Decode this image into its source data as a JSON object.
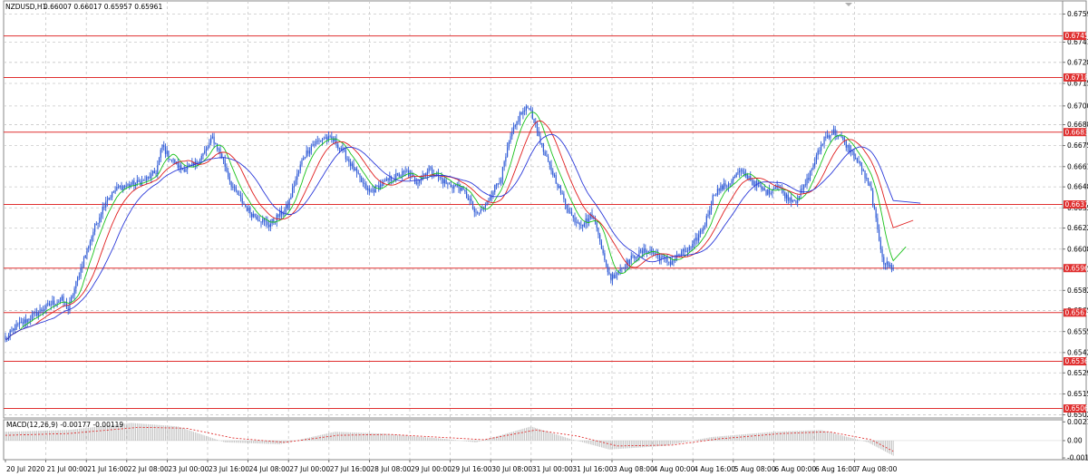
{
  "symbol_info": "NZDUSD,H1",
  "ohlc_info": "0.66007 0.66017 0.65957 0.65961",
  "macd_label": "MACD(12,26,9) -0.00177 -0.00119",
  "colors": {
    "candle": "#2f5bd6",
    "ma_fast": "#19c219",
    "ma_mid": "#e01e1e",
    "ma_slow": "#2b39d9",
    "level": "#e03030",
    "macd_hist": "#b9b9b9",
    "macd_signal": "#e03030"
  },
  "chart_data": {
    "type": "candlestick",
    "price_ticks": [
      "0.67595",
      "0.67415",
      "0.67285",
      "0.67150",
      "0.67005",
      "0.66885",
      "0.66750",
      "0.66615",
      "0.66485",
      "0.66350",
      "0.66220",
      "0.66085",
      "0.65955",
      "0.65820",
      "0.65690",
      "0.65555",
      "0.65420",
      "0.65290",
      "0.65155",
      "0.65020"
    ],
    "levels": [
      "0.67455",
      "0.67188",
      "0.66837",
      "0.66372",
      "0.65963",
      "0.65677",
      "0.65364",
      "0.65061"
    ],
    "macd_ticks": [
      "0.00212",
      "0.00",
      "-0.00195"
    ],
    "time_labels": [
      "20 Jul 2020",
      "21 Jul 00:00",
      "21 Jul 16:00",
      "22 Jul 08:00",
      "23 Jul 00:00",
      "23 Jul 16:00",
      "24 Jul 08:00",
      "27 Jul 00:00",
      "27 Jul 16:00",
      "28 Jul 08:00",
      "29 Jul 00:00",
      "29 Jul 16:00",
      "30 Jul 08:00",
      "31 Jul 00:00",
      "31 Jul 16:00",
      "3 Aug 08:00",
      "4 Aug 00:00",
      "4 Aug 16:00",
      "5 Aug 08:00",
      "6 Aug 00:00",
      "6 Aug 16:00",
      "7 Aug 08:00"
    ],
    "ylim": [
      0.65,
      0.6768
    ],
    "close_path": [
      [
        0,
        0.655
      ],
      [
        6,
        0.6558
      ],
      [
        12,
        0.6562
      ],
      [
        18,
        0.6566
      ],
      [
        24,
        0.657
      ],
      [
        30,
        0.6574
      ],
      [
        36,
        0.6576
      ],
      [
        40,
        0.657
      ],
      [
        48,
        0.6596
      ],
      [
        56,
        0.662
      ],
      [
        64,
        0.664
      ],
      [
        72,
        0.6648
      ],
      [
        80,
        0.665
      ],
      [
        88,
        0.6652
      ],
      [
        96,
        0.6658
      ],
      [
        100,
        0.6675
      ],
      [
        104,
        0.6668
      ],
      [
        112,
        0.666
      ],
      [
        120,
        0.6662
      ],
      [
        128,
        0.6672
      ],
      [
        132,
        0.668
      ],
      [
        138,
        0.6668
      ],
      [
        144,
        0.665
      ],
      [
        150,
        0.664
      ],
      [
        156,
        0.6632
      ],
      [
        162,
        0.6628
      ],
      [
        168,
        0.6624
      ],
      [
        174,
        0.663
      ],
      [
        180,
        0.6636
      ],
      [
        184,
        0.665
      ],
      [
        190,
        0.6668
      ],
      [
        196,
        0.6676
      ],
      [
        204,
        0.668
      ],
      [
        210,
        0.6678
      ],
      [
        216,
        0.667
      ],
      [
        222,
        0.666
      ],
      [
        228,
        0.665
      ],
      [
        232,
        0.6645
      ],
      [
        240,
        0.665
      ],
      [
        248,
        0.6655
      ],
      [
        256,
        0.6658
      ],
      [
        262,
        0.6652
      ],
      [
        270,
        0.666
      ],
      [
        276,
        0.6655
      ],
      [
        282,
        0.665
      ],
      [
        290,
        0.6648
      ],
      [
        296,
        0.664
      ],
      [
        300,
        0.663
      ],
      [
        306,
        0.6636
      ],
      [
        310,
        0.6645
      ],
      [
        316,
        0.6655
      ],
      [
        322,
        0.668
      ],
      [
        328,
        0.6695
      ],
      [
        334,
        0.67
      ],
      [
        338,
        0.6688
      ],
      [
        344,
        0.6668
      ],
      [
        350,
        0.6655
      ],
      [
        356,
        0.664
      ],
      [
        362,
        0.6628
      ],
      [
        368,
        0.6625
      ],
      [
        374,
        0.663
      ],
      [
        378,
        0.662
      ],
      [
        382,
        0.66
      ],
      [
        386,
        0.659
      ],
      [
        394,
        0.6598
      ],
      [
        402,
        0.6605
      ],
      [
        410,
        0.6608
      ],
      [
        418,
        0.6603
      ],
      [
        424,
        0.66
      ],
      [
        430,
        0.6605
      ],
      [
        438,
        0.661
      ],
      [
        446,
        0.6625
      ],
      [
        452,
        0.6645
      ],
      [
        460,
        0.665
      ],
      [
        468,
        0.6658
      ],
      [
        474,
        0.6655
      ],
      [
        480,
        0.6648
      ],
      [
        486,
        0.6645
      ],
      [
        492,
        0.665
      ],
      [
        498,
        0.6642
      ],
      [
        504,
        0.664
      ],
      [
        510,
        0.665
      ],
      [
        516,
        0.6665
      ],
      [
        522,
        0.668
      ],
      [
        528,
        0.6684
      ],
      [
        534,
        0.6678
      ],
      [
        540,
        0.667
      ],
      [
        546,
        0.666
      ],
      [
        552,
        0.6645
      ],
      [
        556,
        0.662
      ],
      [
        560,
        0.66
      ],
      [
        566,
        0.6596
      ]
    ],
    "macd_hist_path": [
      [
        0,
        0.001
      ],
      [
        40,
        0.0012
      ],
      [
        80,
        0.002
      ],
      [
        110,
        0.0016
      ],
      [
        140,
        -0.0002
      ],
      [
        175,
        -0.0004
      ],
      [
        210,
        0.001
      ],
      [
        240,
        0.0008
      ],
      [
        280,
        0.0002
      ],
      [
        300,
        -0.0002
      ],
      [
        335,
        0.0016
      ],
      [
        360,
        0.0002
      ],
      [
        385,
        -0.001
      ],
      [
        420,
        -0.0006
      ],
      [
        450,
        0.0004
      ],
      [
        490,
        0.001
      ],
      [
        520,
        0.0012
      ],
      [
        550,
        -0.0002
      ],
      [
        566,
        -0.0017
      ]
    ],
    "macd_signal_path": [
      [
        0,
        0.0006
      ],
      [
        40,
        0.0008
      ],
      [
        85,
        0.0015
      ],
      [
        115,
        0.0014
      ],
      [
        145,
        0.0003
      ],
      [
        178,
        -0.0002
      ],
      [
        212,
        0.0006
      ],
      [
        245,
        0.0007
      ],
      [
        285,
        0.0003
      ],
      [
        305,
        0.0001
      ],
      [
        338,
        0.0012
      ],
      [
        365,
        0.0005
      ],
      [
        390,
        -0.0006
      ],
      [
        425,
        -0.0005
      ],
      [
        455,
        0.0002
      ],
      [
        495,
        0.0008
      ],
      [
        525,
        0.001
      ],
      [
        552,
        0.0001
      ],
      [
        566,
        -0.0012
      ]
    ]
  }
}
